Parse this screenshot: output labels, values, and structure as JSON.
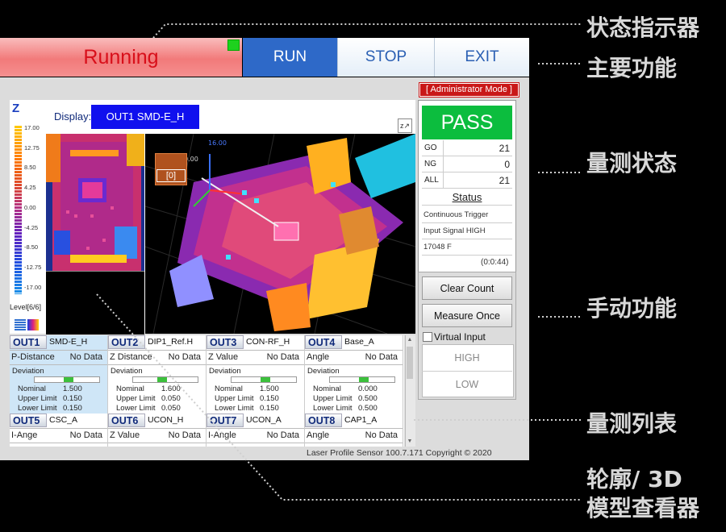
{
  "topbar": {
    "status": "Running",
    "run_label": "RUN",
    "stop_label": "STOP",
    "exit_label": "EXIT"
  },
  "mode_badge": "[ Administrator Mode ]",
  "viewer": {
    "z_label": "Z",
    "scale_ticks": [
      "17.00",
      "12.75",
      "8.50",
      "4.25",
      "0.00",
      "-4.25",
      "-8.50",
      "-12.75",
      "-17.00"
    ],
    "level": "Level[6/6]",
    "display_label": "Display:",
    "display_value": "OUT1 SMD-E_H",
    "axis_labels": {
      "z": "16.00",
      "x": "0.00"
    },
    "roi_index": "[0]"
  },
  "results": {
    "judgement": "PASS",
    "counts": [
      {
        "label": "GO",
        "value": "21"
      },
      {
        "label": "NG",
        "value": "0"
      },
      {
        "label": "ALL",
        "value": "21"
      }
    ],
    "status_heading": "Status",
    "status_lines": [
      "Continuous Trigger",
      "Input Signal HIGH",
      "17048 F"
    ],
    "timer": "(0:0:44)"
  },
  "manual": {
    "clear_count": "Clear Count",
    "measure_once": "Measure Once",
    "virtual_input": "Virtual Input",
    "high": "HIGH",
    "low": "LOW"
  },
  "outputs": [
    {
      "id": "OUT1",
      "name": "SMD-E_H",
      "measure": "P-Distance",
      "value": "No Data",
      "deviation": "Deviation",
      "dev_pos": 0.45,
      "nominal": "Nominal",
      "nominal_v": "1.500",
      "upper": "Upper Limit",
      "upper_v": "0.150",
      "lower": "Lower Limit",
      "lower_v": "0.150",
      "selected": true
    },
    {
      "id": "OUT2",
      "name": "DIP1_Ref.H",
      "measure": "Z Distance",
      "value": "No Data",
      "deviation": "Deviation",
      "dev_pos": 0.38,
      "nominal": "Nominal",
      "nominal_v": "1.600",
      "upper": "Upper Limit",
      "upper_v": "0.050",
      "lower": "Lower Limit",
      "lower_v": "0.050",
      "selected": false
    },
    {
      "id": "OUT3",
      "name": "CON-RF_H",
      "measure": "Z Value",
      "value": "No Data",
      "deviation": "Deviation",
      "dev_pos": 0.45,
      "nominal": "Nominal",
      "nominal_v": "1.500",
      "upper": "Upper Limit",
      "upper_v": "0.150",
      "lower": "Lower Limit",
      "lower_v": "0.150",
      "selected": false
    },
    {
      "id": "OUT4",
      "name": "Base_A",
      "measure": "Angle",
      "value": "No Data",
      "deviation": "Deviation",
      "dev_pos": 0.45,
      "nominal": "Nominal",
      "nominal_v": "0.000",
      "upper": "Upper Limit",
      "upper_v": "0.500",
      "lower": "Lower Limit",
      "lower_v": "0.500",
      "selected": false
    },
    {
      "id": "OUT5",
      "name": "CSC_A",
      "measure": "I-Ange",
      "value": "No Data"
    },
    {
      "id": "OUT6",
      "name": "UCON_H",
      "measure": "Z Value",
      "value": "No Data"
    },
    {
      "id": "OUT7",
      "name": "UCON_A",
      "measure": "I-Angle",
      "value": "No Data"
    },
    {
      "id": "OUT8",
      "name": "CAP1_A",
      "measure": "Angle",
      "value": "No Data"
    }
  ],
  "footer": "Laser Profile Sensor 100.7.171  Copyright © 2020",
  "annotations": {
    "status_indicator": "状态指示器",
    "main_functions": "主要功能",
    "measure_status": "量测状态",
    "manual_functions": "手动功能",
    "measure_list": "量测列表",
    "viewer_line1": "轮廓/ 3D",
    "viewer_line2": "模型查看器"
  },
  "colors": {
    "accent": "#2e69c8",
    "pass": "#0cbd3e",
    "running": "#d80f1a",
    "badge": "#c91818"
  }
}
